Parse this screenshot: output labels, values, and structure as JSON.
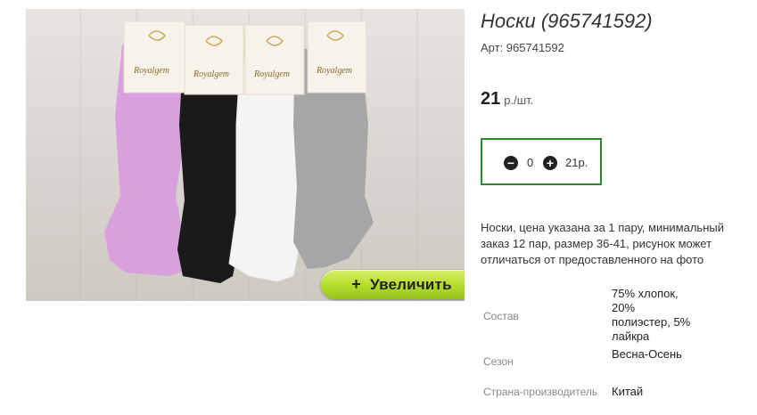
{
  "product": {
    "title": "Носки (965741592)",
    "article_label": "Арт: 965741592",
    "price_value": "21",
    "price_unit": "р./шт.",
    "description": "Носки, цена указана за 1 пару, минимальный заказ 12 пар, размер 36-41, рисунок может отличаться от предоставленного на фото"
  },
  "image": {
    "zoom_label": "Увеличить",
    "zoom_plus": "+",
    "brand_text": "Royalgem"
  },
  "cart": {
    "minus_icon": "minus-circle-icon",
    "plus_icon": "plus-circle-icon",
    "quantity": "0",
    "sum": "21р."
  },
  "properties": [
    {
      "key": "Состав",
      "value": "75% хлопок, 20% полиэстер, 5% лайкра"
    },
    {
      "key": "Сезон",
      "value": "Весна-Осень"
    },
    {
      "key": "Страна-производитель",
      "value": "Китай"
    }
  ],
  "colors": {
    "accent_green": "#2a8a2a",
    "zoom_button": "#b3dc2a",
    "sock_colors": [
      "#d8a0dc",
      "#1a1a1a",
      "#f4f4f4",
      "#a6a6a6"
    ]
  }
}
